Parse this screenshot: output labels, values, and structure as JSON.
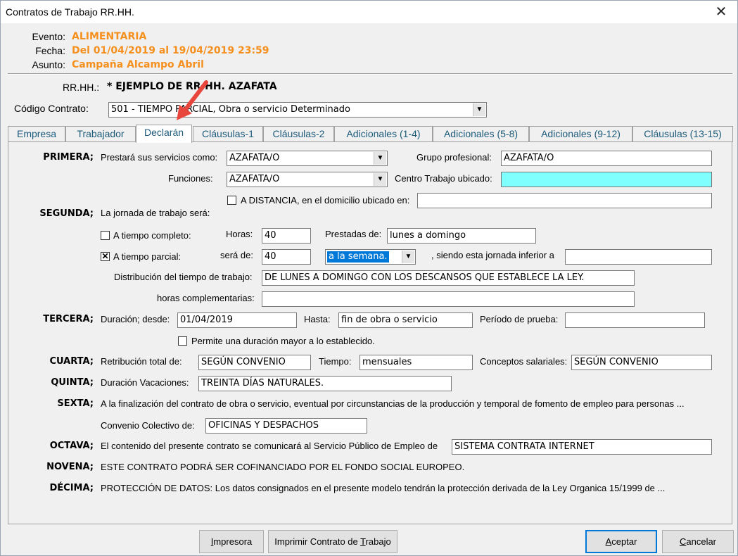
{
  "window": {
    "title": "Contratos de Trabajo RR.HH.",
    "close_glyph": "✕"
  },
  "header": {
    "evento_label": "Evento:",
    "evento": "ALIMENTARIA",
    "fecha_label": "Fecha:",
    "fecha": "Del 01/04/2019 al 19/04/2019 23:59",
    "asunto_label": "Asunto:",
    "asunto": "Campaña Alcampo Abril",
    "rrhh_label": "RR.HH.:",
    "rrhh": "* EJEMPLO DE RR.HH. AZAFATA",
    "codigo_label": "Código Contrato:",
    "codigo": "501 - TIEMPO PARCIAL, Obra o servicio Determinado",
    "accent_color": "#f5901e"
  },
  "tabs": [
    {
      "label": "Empresa"
    },
    {
      "label": "Trabajador"
    },
    {
      "label": "Declarán",
      "active": true
    },
    {
      "label": "Cláusulas-1"
    },
    {
      "label": "Cláusulas-2"
    },
    {
      "label": "Adicionales (1-4)"
    },
    {
      "label": "Adicionales (5-8)"
    },
    {
      "label": "Adicionales (9-12)"
    },
    {
      "label": "Cláusulas (13-15)"
    }
  ],
  "primera": {
    "title": "PRIMERA;",
    "servicios_label": "Prestará sus servicios como:",
    "servicios": "AZAFATA/O",
    "grupo_label": "Grupo profesional:",
    "grupo": "AZAFATA/O",
    "funciones_label": "Funciones:",
    "funciones": "AZAFATA/O",
    "centro_label": "Centro Trabajo ubicado:",
    "centro": "",
    "distancia_label": "A DISTANCIA, en el domicilio ubicado en:",
    "distancia": "",
    "distancia_checked": false
  },
  "segunda": {
    "title": "SEGUNDA;",
    "jornada_label": "La jornada de trabajo será:",
    "completo_label": "A tiempo completo:",
    "completo_checked": false,
    "horas_label": "Horas:",
    "horas": "40",
    "prestadas_label": "Prestadas de:",
    "prestadas": "lunes a domingo",
    "parcial_label": "A tiempo parcial:",
    "parcial_checked": true,
    "check_glyph": "✕",
    "sera_label": "será de:",
    "sera": "40",
    "periodo": "a la semana.",
    "inferior_label": ", siendo esta jornada inferior a",
    "inferior": "",
    "distribucion_label": "Distribución del tiempo de trabajo:",
    "distribucion": "DE LUNES A DOMINGO CON LOS DESCANSOS QUE ESTABLECE LA LEY.",
    "complementarias_label": "horas complementarias:",
    "complementarias": ""
  },
  "tercera": {
    "title": "TERCERA;",
    "desde_label": "Duración; desde:",
    "desde": "01/04/2019",
    "hasta_label": "Hasta:",
    "hasta": "fin de obra o servicio",
    "prueba_label": "Período de prueba:",
    "prueba": "",
    "mayor_label": "Permite una duración mayor a lo establecido.",
    "mayor_checked": false
  },
  "cuarta": {
    "title": "CUARTA;",
    "retribucion_label": "Retribución total de:",
    "retribucion": "SEGÚN CONVENIO",
    "tiempo_label": "Tiempo:",
    "tiempo": "mensuales",
    "conceptos_label": "Conceptos salariales:",
    "conceptos": "SEGÚN CONVENIO"
  },
  "quinta": {
    "title": "QUINTA;",
    "vacaciones_label": "Duración Vacaciones:",
    "vacaciones": "TREINTA DÍAS NATURALES."
  },
  "sexta": {
    "title": "SEXTA;",
    "text": "A la finalización del contrato de obra o servicio, eventual por circunstancias de la producción y temporal de fomento de empleo para personas ...",
    "convenio_label": "Convenio Colectivo de:",
    "convenio": "OFICINAS Y DESPACHOS"
  },
  "octava": {
    "title": "OCTAVA;",
    "text": "El contenido del presente contrato se comunicará al Servicio Público de Empleo de",
    "servicio": "SISTEMA CONTRATA INTERNET"
  },
  "novena": {
    "title": "NOVENA;",
    "text": "ESTE CONTRATO PODRÁ SER COFINANCIADO POR EL FONDO SOCIAL EUROPEO."
  },
  "decima": {
    "title": "DÉCIMA;",
    "text": "PROTECCIÓN DE DATOS: Los datos consignados en el presente modelo tendrán la protección derivada de la Ley Organica 15/1999 de ..."
  },
  "buttons": {
    "impresora_pre": "",
    "impresora_u": "I",
    "impresora_post": "mpresora",
    "imprimir_pre": "Imprimir Contrato de ",
    "imprimir_u": "T",
    "imprimir_post": "rabajo",
    "aceptar_pre": "",
    "aceptar_u": "A",
    "aceptar_post": "ceptar",
    "cancelar_pre": "",
    "cancelar_u": "C",
    "cancelar_post": "ancelar"
  },
  "annotation": {
    "arrow_color": "#e8453c"
  }
}
